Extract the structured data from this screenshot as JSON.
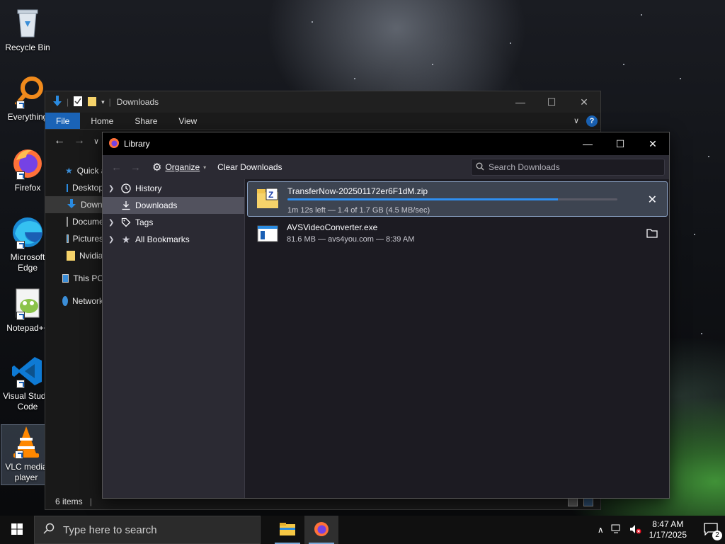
{
  "desktop": {
    "icons": [
      {
        "label": "Recycle Bin",
        "icon": "recycle-bin-icon"
      },
      {
        "label": "Everything",
        "icon": "everything-icon"
      },
      {
        "label": "Firefox",
        "icon": "firefox-icon"
      },
      {
        "label": "Microsoft Edge",
        "icon": "edge-icon"
      },
      {
        "label": "Notepad++",
        "icon": "notepadpp-icon"
      },
      {
        "label": "Visual Studio Code",
        "icon": "vscode-icon"
      },
      {
        "label": "VLC media player",
        "icon": "vlc-icon"
      }
    ]
  },
  "explorer": {
    "title": "Downloads",
    "ribbon_tabs": [
      "File",
      "Home",
      "Share",
      "View"
    ],
    "sidebar": [
      {
        "label": "Quick access",
        "icon": "star-icon"
      },
      {
        "label": "Desktop",
        "icon": "desktop-folder-icon"
      },
      {
        "label": "Downloads",
        "icon": "download-arrow-icon"
      },
      {
        "label": "Documents",
        "icon": "documents-icon"
      },
      {
        "label": "Pictures",
        "icon": "pictures-icon"
      },
      {
        "label": "Nvidia",
        "icon": "folder-icon"
      },
      {
        "label": "This PC",
        "icon": "computer-icon"
      },
      {
        "label": "Network",
        "icon": "network-icon"
      }
    ],
    "status": "6 items"
  },
  "library": {
    "title": "Library",
    "toolbar": {
      "organize": "Organize",
      "clear_downloads": "Clear Downloads",
      "search_placeholder": "Search Downloads"
    },
    "sidebar": [
      {
        "label": "History",
        "icon": "clock-icon",
        "expandable": true
      },
      {
        "label": "Downloads",
        "icon": "download-icon",
        "expandable": false
      },
      {
        "label": "Tags",
        "icon": "tag-icon",
        "expandable": true
      },
      {
        "label": "All Bookmarks",
        "icon": "star-icon",
        "expandable": true
      }
    ],
    "downloads": [
      {
        "name": "TransferNow-202501172er6F1dM.zip",
        "status": "1m 12s left — 1.4 of 1.7 GB (4.5 MB/sec)",
        "progress": 0.82,
        "icon": "zip-archive-icon",
        "action": "cancel-icon"
      },
      {
        "name": "AVSVideoConverter.exe",
        "status": "81.6 MB — avs4you.com — 8:39 AM",
        "icon": "exe-file-icon",
        "action": "folder-icon"
      }
    ]
  },
  "taskbar": {
    "search_placeholder": "Type here to search",
    "time": "8:47 AM",
    "date": "1/17/2025",
    "notification_count": "2"
  },
  "colors": {
    "accent": "#1a63b6",
    "progress": "#2f8ff0",
    "library_bg": "#2b2a33",
    "list_bg": "#1c1b22"
  }
}
